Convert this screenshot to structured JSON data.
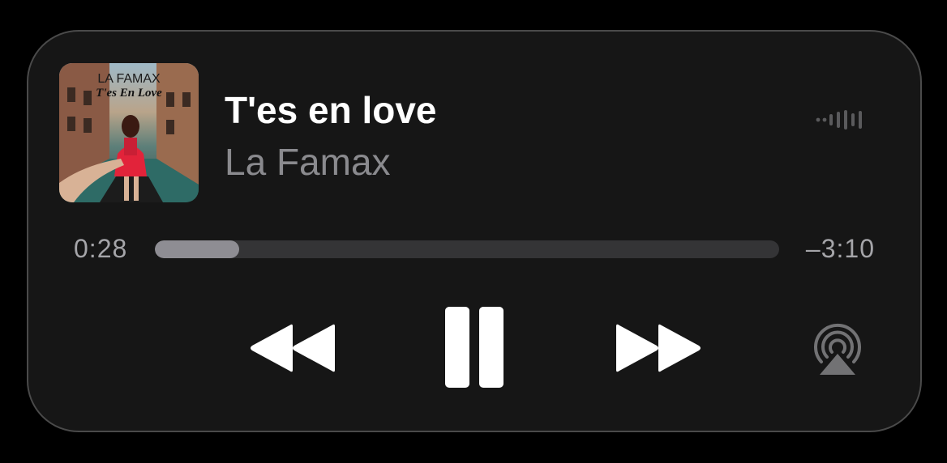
{
  "track": {
    "title": "T'es en love",
    "artist": "La Famax",
    "album_art": {
      "icon": "album-art",
      "text_artist": "LA FAMAX",
      "text_title": "T'es En Love"
    }
  },
  "playback": {
    "elapsed": "0:28",
    "remaining": "–3:10",
    "progress_fraction": 0.135
  },
  "controls": {
    "rewind": "rewind-icon",
    "pause": "pause-icon",
    "forward": "fast-forward-icon",
    "airplay": "airplay-icon",
    "waveform": "audio-waveform-icon"
  },
  "colors": {
    "background": "#161616",
    "title": "#ffffff",
    "artist": "#8a8a8e",
    "progress_track": "#343436",
    "progress_fill": "#8e8d93"
  }
}
